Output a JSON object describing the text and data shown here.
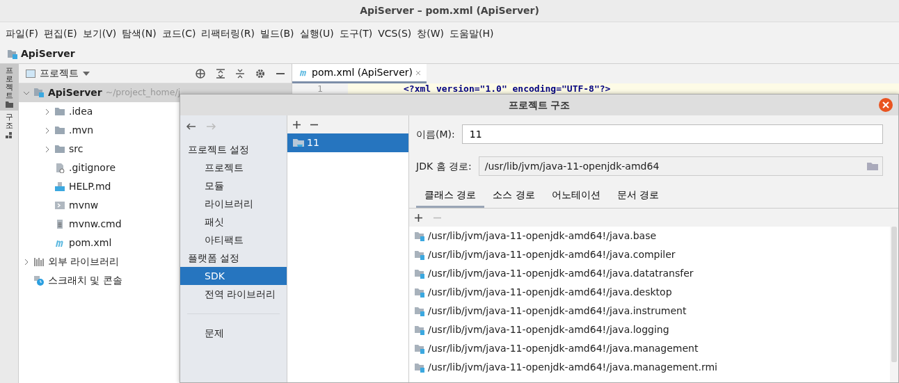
{
  "window": {
    "title": "ApiServer – pom.xml (ApiServer)"
  },
  "menu": [
    "파일(F)",
    "편집(E)",
    "보기(V)",
    "탐색(N)",
    "코드(C)",
    "리팩터링(R)",
    "빌드(B)",
    "실행(U)",
    "도구(T)",
    "VCS(S)",
    "창(W)",
    "도움말(H)"
  ],
  "breadcrumb": "ApiServer",
  "side_strip": [
    {
      "label": "프로젝트",
      "selected": true
    },
    {
      "label": "구조",
      "selected": false
    }
  ],
  "project_panel": {
    "title": "프로젝트",
    "tree": [
      {
        "label": "ApiServer",
        "path": "~/project_home/j",
        "kind": "module",
        "expanded": true,
        "selected": true,
        "children": [
          {
            "label": ".idea",
            "kind": "folder",
            "expanded": false
          },
          {
            "label": ".mvn",
            "kind": "folder",
            "expanded": false
          },
          {
            "label": "src",
            "kind": "folder",
            "expanded": false
          },
          {
            "label": ".gitignore",
            "kind": "ignore"
          },
          {
            "label": "HELP.md",
            "kind": "md"
          },
          {
            "label": "mvnw",
            "kind": "exec"
          },
          {
            "label": "mvnw.cmd",
            "kind": "text"
          },
          {
            "label": "pom.xml",
            "kind": "maven"
          }
        ]
      },
      {
        "label": "외부 라이브러리",
        "kind": "libs",
        "expanded": false
      },
      {
        "label": "스크래치 및 콘솔",
        "kind": "scratch"
      }
    ]
  },
  "editor": {
    "tabs": [
      {
        "label": "pom.xml (ApiServer)",
        "selected": true
      }
    ],
    "line_number": "1",
    "code": "<?xml version=\"1.0\" encoding=\"UTF-8\"?>"
  },
  "dialog": {
    "title": "프로젝트 구조",
    "nav": [
      {
        "kind": "header",
        "label": "프로젝트 설정"
      },
      {
        "kind": "item",
        "label": "프로젝트",
        "selected": false
      },
      {
        "kind": "item",
        "label": "모듈",
        "selected": false
      },
      {
        "kind": "item",
        "label": "라이브러리",
        "selected": false
      },
      {
        "kind": "item",
        "label": "패싯",
        "selected": false
      },
      {
        "kind": "item",
        "label": "아티팩트",
        "selected": false
      },
      {
        "kind": "header",
        "label": "플랫폼 설정"
      },
      {
        "kind": "item",
        "label": "SDK",
        "selected": true
      },
      {
        "kind": "item",
        "label": "전역 라이브러리",
        "selected": false
      },
      {
        "kind": "divider"
      },
      {
        "kind": "item",
        "label": "문제",
        "selected": false
      }
    ],
    "sdks": [
      {
        "label": "11",
        "selected": true
      }
    ],
    "name_label": "이름(M):",
    "name_value": "11",
    "home_label": "JDK 홈 경로:",
    "home_value": "/usr/lib/jvm/java-11-openjdk-amd64",
    "tabs": [
      {
        "label": "클래스 경로",
        "selected": true
      },
      {
        "label": "소스 경로",
        "selected": false
      },
      {
        "label": "어노테이션",
        "selected": false
      },
      {
        "label": "문서 경로",
        "selected": false
      }
    ],
    "remove_disabled": true,
    "paths": [
      "/usr/lib/jvm/java-11-openjdk-amd64!/java.base",
      "/usr/lib/jvm/java-11-openjdk-amd64!/java.compiler",
      "/usr/lib/jvm/java-11-openjdk-amd64!/java.datatransfer",
      "/usr/lib/jvm/java-11-openjdk-amd64!/java.desktop",
      "/usr/lib/jvm/java-11-openjdk-amd64!/java.instrument",
      "/usr/lib/jvm/java-11-openjdk-amd64!/java.logging",
      "/usr/lib/jvm/java-11-openjdk-amd64!/java.management",
      "/usr/lib/jvm/java-11-openjdk-amd64!/java.management.rmi"
    ]
  }
}
